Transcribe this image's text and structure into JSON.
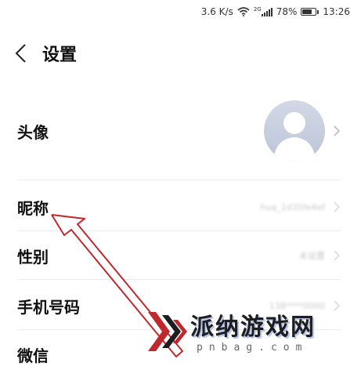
{
  "status_bar": {
    "net_speed": "3.6 K/s",
    "network_type": "2G",
    "battery_percent": "78%",
    "battery_level": 0.78,
    "time": "13:26"
  },
  "header": {
    "title": "设置"
  },
  "rows": {
    "avatar": {
      "label": "头像"
    },
    "nickname": {
      "label": "昵称",
      "value": "hua_1d35fe4ef"
    },
    "gender": {
      "label": "性别",
      "value": "未设置"
    },
    "phone": {
      "label": "手机号码",
      "value": "138****0000"
    },
    "wechat": {
      "label": "微信"
    }
  },
  "watermark": {
    "main": "派纳游戏网",
    "sub": "pnbag.com"
  },
  "colors": {
    "annotation_arrow": "#c0282d",
    "chevron": "#bdbdbd",
    "avatar_bg": "#c9d0e1"
  }
}
